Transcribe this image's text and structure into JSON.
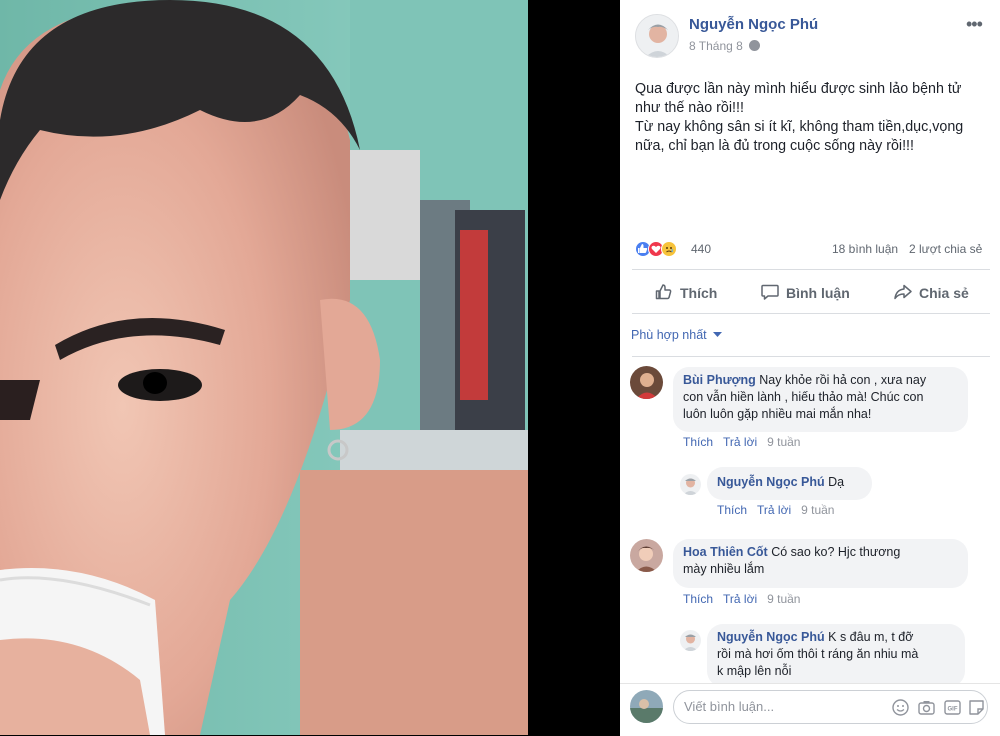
{
  "post": {
    "author": "Nguyễn Ngọc Phú",
    "date": "8 Tháng 8",
    "text_lines": [
      "Qua được lần này mình hiểu được sinh lảo bệnh tử",
      "như thế nào rồi!!!",
      "Từ nay không sân si ít kĩ, không tham tiền,dục,vọng",
      "nữa, chỉ bạn là đủ trong cuộc sống này rồi!!!"
    ],
    "reaction_count": "440",
    "comments_count": "18 bình luận",
    "shares_count": "2 lượt chia sẻ"
  },
  "actions": {
    "like": "Thích",
    "comment": "Bình luận",
    "share": "Chia sẻ"
  },
  "sort_label": "Phù hợp nhất",
  "comments": [
    {
      "name": "Bùi Phượng",
      "lines": [
        "Nay khỏe rồi hả con , xưa nay",
        "con vẫn hiền lành , hiếu thảo mà! Chúc con",
        "luôn luôn gặp nhiều mai mắn nha!"
      ],
      "like": "Thích",
      "reply": "Trả lời",
      "time": "9 tuần"
    },
    {
      "name": "Nguyễn Ngọc Phú",
      "lines": [
        "Dạ"
      ],
      "like": "Thích",
      "reply": "Trả lời",
      "time": "9 tuần"
    },
    {
      "name": "Hoa Thiên Cốt",
      "lines": [
        "Có sao ko? Hjc thương",
        "mày nhiều lắm"
      ],
      "like": "Thích",
      "reply": "Trả lời",
      "time": "9 tuần"
    },
    {
      "name": "Nguyễn Ngọc Phú",
      "lines": [
        "K s đâu m, t đỡ",
        "rồi mà hơi ốm thôi t ráng ăn nhiu mà",
        "k mập lên nỗi"
      ]
    }
  ],
  "composer": {
    "placeholder": "Viết bình luận..."
  },
  "colors": {
    "link": "#385898",
    "accent": "#4267b2",
    "like_blue": "#4a7ff0",
    "love_red": "#f0384d",
    "sad_yellow": "#f7c33b"
  },
  "icons": [
    "globe-icon",
    "more-icon",
    "like-reaction-icon",
    "love-reaction-icon",
    "sad-reaction-icon",
    "thumbs-up-icon",
    "comment-icon",
    "share-icon",
    "chevron-down-icon",
    "emoji-icon",
    "camera-icon",
    "gif-icon",
    "sticker-icon"
  ]
}
